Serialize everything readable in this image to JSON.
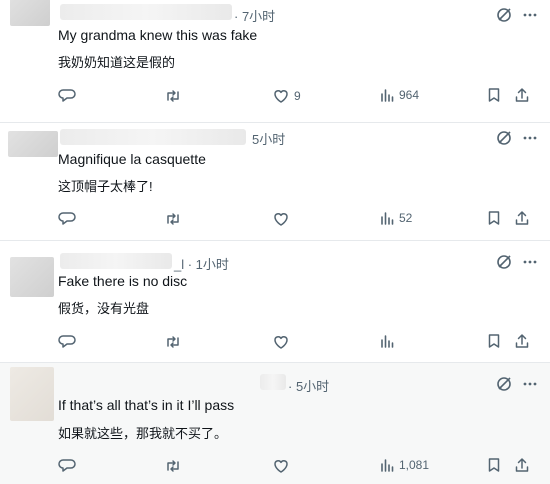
{
  "tweets": [
    {
      "time": "· 7小时",
      "text_en": "My grandma knew this was fake",
      "text_zh": "我奶奶知道这是假的",
      "likes": "9",
      "views": "964"
    },
    {
      "time": "5小时",
      "text_en": "Magnifique la casquette",
      "text_zh": "这顶帽子太棒了!",
      "likes": "",
      "views": "52"
    },
    {
      "time": "_l · 1小时",
      "text_en": "Fake there is no disc",
      "text_zh": "假货，没有光盘",
      "likes": "",
      "views": ""
    },
    {
      "time": "· 5小时",
      "text_en": "If that’s all that’s in it I’ll pass",
      "text_zh": "如果就这些，那我就不买了。",
      "likes": "",
      "views": "1,081"
    }
  ],
  "icons": {
    "grok": "grok-icon",
    "more": "more-icon",
    "reply": "reply-icon",
    "retweet": "retweet-icon",
    "like": "like-icon",
    "views": "views-icon",
    "bookmark": "bookmark-icon",
    "share": "share-icon"
  },
  "colors": {
    "text": "#0f1419",
    "muted": "#536471",
    "separator": "#e6e9ec",
    "hover_bg": "#f7f8f8"
  }
}
